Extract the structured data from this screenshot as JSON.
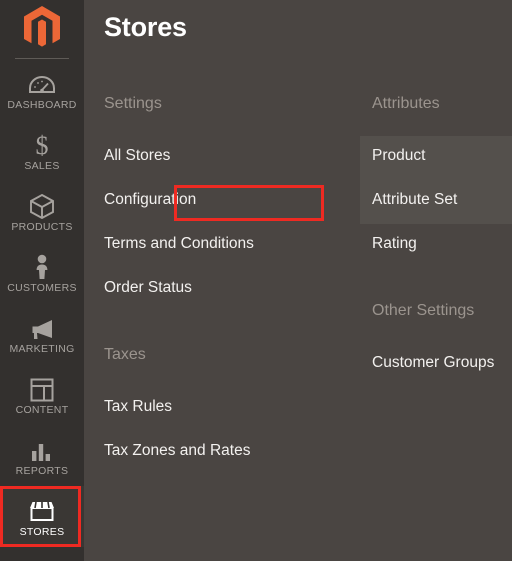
{
  "brand": {
    "logo_icon": "magento-logo-icon",
    "logo_color": "#ec6737"
  },
  "sidebar": {
    "items": [
      {
        "label": "DASHBOARD",
        "icon": "gauge-icon",
        "active": false
      },
      {
        "label": "SALES",
        "icon": "dollar-icon",
        "active": false
      },
      {
        "label": "PRODUCTS",
        "icon": "box-icon",
        "active": false
      },
      {
        "label": "CUSTOMERS",
        "icon": "person-icon",
        "active": false
      },
      {
        "label": "MARKETING",
        "icon": "megaphone-icon",
        "active": false
      },
      {
        "label": "CONTENT",
        "icon": "layout-icon",
        "active": false
      },
      {
        "label": "REPORTS",
        "icon": "bar-chart-icon",
        "active": false
      },
      {
        "label": "STORES",
        "icon": "storefront-icon",
        "active": true
      }
    ]
  },
  "main": {
    "title": "Stores",
    "columns": [
      {
        "name": "left",
        "groups": [
          {
            "heading": "Settings",
            "items": [
              {
                "label": "All Stores"
              },
              {
                "label": "Configuration",
                "highlighted": true
              },
              {
                "label": "Terms and Conditions"
              },
              {
                "label": "Order Status"
              }
            ]
          },
          {
            "heading": "Taxes",
            "items": [
              {
                "label": "Tax Rules"
              },
              {
                "label": "Tax Zones and Rates"
              }
            ]
          }
        ]
      },
      {
        "name": "right",
        "groups": [
          {
            "heading": "Attributes",
            "items": [
              {
                "label": "Product"
              },
              {
                "label": "Attribute Set"
              },
              {
                "label": "Rating"
              }
            ]
          },
          {
            "heading": "Other Settings",
            "items": [
              {
                "label": "Customer Groups"
              }
            ]
          }
        ]
      }
    ]
  },
  "annotation": {
    "highlight_color": "#ee2a22",
    "target_label": "Configuration",
    "active_nav_label": "STORES"
  },
  "colors": {
    "sidebar_bg": "#33302e",
    "panel_bg": "#4a4542",
    "panel_highlight_bg": "#54504c",
    "heading_text": "#9b948e",
    "link_text": "#f3f1ef",
    "accent_red": "#ee2a22",
    "brand_orange": "#ec6737"
  }
}
